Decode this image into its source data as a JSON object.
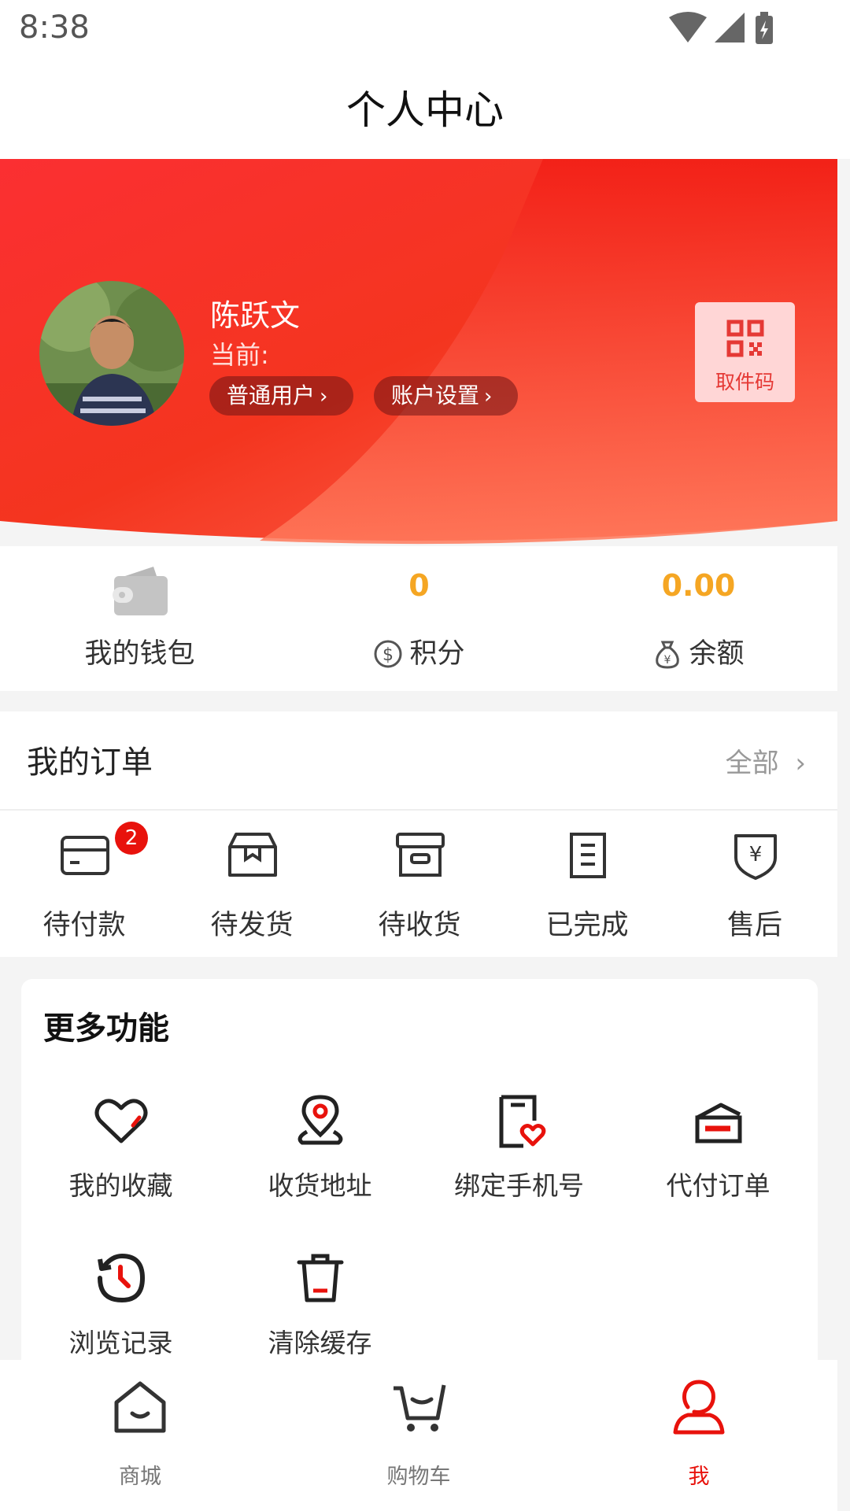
{
  "status_bar": {
    "time": "8:38",
    "icons": [
      "wifi-icon",
      "signal-icon",
      "battery-charging-icon"
    ]
  },
  "header": {
    "title": "个人中心"
  },
  "profile": {
    "name": "陈跃文",
    "current_label": "当前:",
    "user_type_button": "普通用户",
    "account_settings_button": "账户设置",
    "qr_label": "取件码",
    "accent_color": "#f0211c"
  },
  "wallet": {
    "wallet_label": "我的钱包",
    "points_value": "0",
    "points_label": "积分",
    "balance_value": "0.00",
    "balance_label": "余额",
    "value_color": "#f5a623"
  },
  "orders": {
    "title": "我的订单",
    "all_label": "全部",
    "items": [
      {
        "label": "待付款",
        "icon": "card-icon",
        "badge": "2"
      },
      {
        "label": "待发货",
        "icon": "box-icon"
      },
      {
        "label": "待收货",
        "icon": "archive-icon"
      },
      {
        "label": "已完成",
        "icon": "document-icon"
      },
      {
        "label": "售后",
        "icon": "yuan-shield-icon"
      }
    ]
  },
  "more_functions": {
    "title": "更多功能",
    "items": [
      {
        "label": "我的收藏",
        "icon": "heart-icon"
      },
      {
        "label": "收货地址",
        "icon": "location-pin-icon"
      },
      {
        "label": "绑定手机号",
        "icon": "phone-heart-icon"
      },
      {
        "label": "代付订单",
        "icon": "pay-order-icon"
      },
      {
        "label": "浏览记录",
        "icon": "history-icon"
      },
      {
        "label": "清除缓存",
        "icon": "trash-icon"
      }
    ]
  },
  "tabbar": {
    "items": [
      {
        "label": "商城",
        "icon": "home-icon"
      },
      {
        "label": "购物车",
        "icon": "cart-icon"
      },
      {
        "label": "我",
        "icon": "user-icon",
        "active": true
      }
    ],
    "active_color": "#e8120c"
  }
}
